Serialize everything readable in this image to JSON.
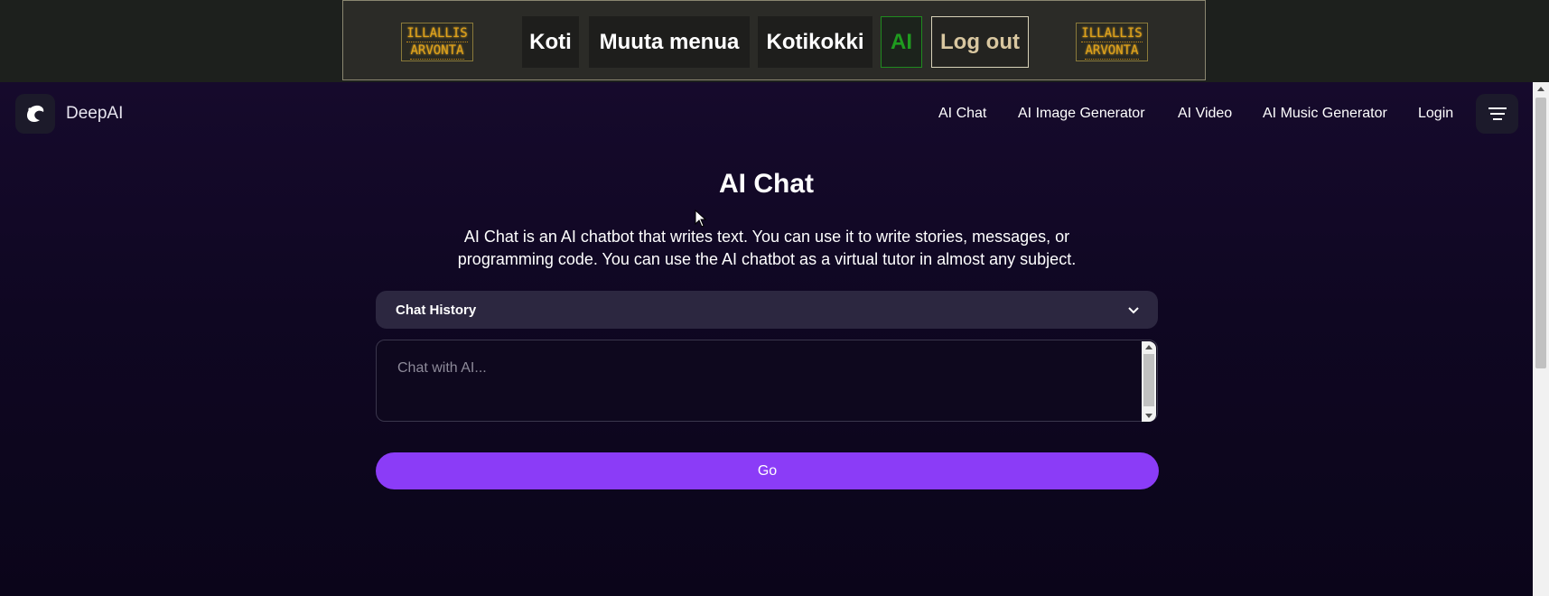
{
  "host_nav": {
    "logo_line1": "ILLALLIS",
    "logo_line2": "ARVONTA",
    "links": [
      "Koti",
      "Muuta menua",
      "Kotikokki",
      "AI",
      "Log out"
    ]
  },
  "deepai": {
    "brand": "DeepAI",
    "nav": [
      "AI Chat",
      "AI Image Generator",
      "AI Video",
      "AI Music Generator",
      "Login"
    ],
    "title": "AI Chat",
    "description_line1": "AI Chat is an AI chatbot that writes text. You can use it to write stories, messages, or",
    "description_line2": "programming code. You can use the AI chatbot as a virtual tutor in almost any subject.",
    "history_label": "Chat History",
    "chat_placeholder": "Chat with AI...",
    "go_label": "Go"
  },
  "icons": {
    "logo": "illallis-arvonta-logo",
    "brand": "deepai-dolphin-icon",
    "menu": "hamburger-menu-icon",
    "history_toggle": "chevron-down-icon",
    "pointer": "mouse-cursor-icon"
  },
  "colors": {
    "accent": "#8b3cf7",
    "ai_link": "#1f9b1f",
    "logo_text": "#e0a21a"
  }
}
